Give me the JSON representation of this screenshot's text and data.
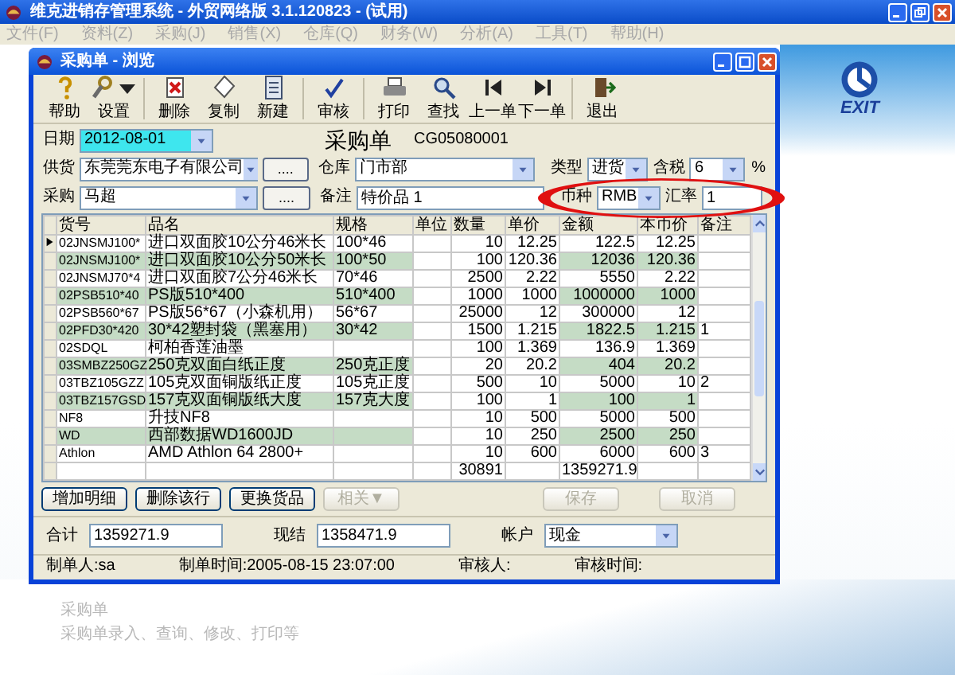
{
  "app": {
    "title": "维克进销存管理系统 - 外贸网络版 3.1.120823 - (试用)",
    "menu": [
      "文件(F)",
      "资料(Z)",
      "采购(J)",
      "销售(X)",
      "仓库(Q)",
      "财务(W)",
      "分析(A)",
      "工具(T)",
      "帮助(H)"
    ]
  },
  "dialog": {
    "title": "采购单 - 浏览",
    "toolbar": [
      {
        "label": "帮助",
        "has_menu": false
      },
      {
        "label": "设置",
        "has_menu": true
      },
      {
        "label": "删除",
        "has_menu": false
      },
      {
        "label": "复制",
        "has_menu": false
      },
      {
        "label": "新建",
        "has_menu": false
      },
      {
        "label": "审核",
        "has_menu": false
      },
      {
        "label": "打印",
        "has_menu": false
      },
      {
        "label": "查找",
        "has_menu": false
      },
      {
        "label": "上一单",
        "has_menu": false
      },
      {
        "label": "下一单",
        "has_menu": false
      },
      {
        "label": "退出",
        "has_menu": false
      }
    ],
    "form": {
      "heading": "采购单",
      "number": "CG05080001",
      "date": {
        "label": "日期",
        "value": "2012-08-01",
        "focused": true
      },
      "supplier": {
        "label": "供货",
        "value": "东莞莞东电子有限公司",
        "browse": "...."
      },
      "warehouse": {
        "label": "仓库",
        "value": "门市部"
      },
      "type": {
        "label": "类型",
        "value": "进货"
      },
      "tax": {
        "label": "含税",
        "value": "6",
        "unit": "%"
      },
      "buyer": {
        "label": "采购",
        "value": "马超",
        "browse": "...."
      },
      "note": {
        "label": "备注",
        "value": "特价品 1"
      },
      "currency": {
        "label": "币种",
        "value": "RMB"
      },
      "rate": {
        "label": "汇率",
        "value": "1"
      }
    },
    "table": {
      "columns": [
        "货号",
        "品名",
        "规格",
        "单位",
        "数量",
        "单价",
        "金额",
        "本币价",
        "备注"
      ],
      "rows": [
        {
          "selected": true,
          "cells": [
            "02JNSMJ100*",
            "进口双面胶10公分46米长",
            "100*46",
            "",
            "10",
            "12.25",
            "122.5",
            "12.25",
            ""
          ]
        },
        {
          "selected": false,
          "cells": [
            "02JNSMJ100*",
            "进口双面胶10公分50米长",
            "100*50",
            "",
            "100",
            "120.36",
            "12036",
            "120.36",
            ""
          ]
        },
        {
          "selected": false,
          "cells": [
            "02JNSMJ70*4",
            "进口双面胶7公分46米长",
            "70*46",
            "",
            "2500",
            "2.22",
            "5550",
            "2.22",
            ""
          ]
        },
        {
          "selected": false,
          "cells": [
            "02PSB510*40",
            "PS版510*400",
            "510*400",
            "",
            "1000",
            "1000",
            "1000000",
            "1000",
            ""
          ]
        },
        {
          "selected": false,
          "cells": [
            "02PSB560*67",
            "PS版56*67（小森机用）",
            "56*67",
            "",
            "25000",
            "12",
            "300000",
            "12",
            ""
          ]
        },
        {
          "selected": false,
          "cells": [
            "02PFD30*420",
            "30*42塑封袋（黑塞用）",
            "30*42",
            "",
            "1500",
            "1.215",
            "1822.5",
            "1.215",
            "1"
          ]
        },
        {
          "selected": false,
          "cells": [
            "02SDQL",
            "柯柏香莲油墨",
            "",
            "",
            "100",
            "1.369",
            "136.9",
            "1.369",
            ""
          ]
        },
        {
          "selected": false,
          "cells": [
            "03SMBZ250GZ",
            "250克双面白纸正度",
            "250克正度",
            "",
            "20",
            "20.2",
            "404",
            "20.2",
            ""
          ]
        },
        {
          "selected": false,
          "cells": [
            "03TBZ105GZZ",
            "105克双面铜版纸正度",
            "105克正度",
            "",
            "500",
            "10",
            "5000",
            "10",
            "2"
          ]
        },
        {
          "selected": false,
          "cells": [
            "03TBZ157GSD",
            "157克双面铜版纸大度",
            "157克大度",
            "",
            "100",
            "1",
            "100",
            "1",
            ""
          ]
        },
        {
          "selected": false,
          "cells": [
            "NF8",
            "升技NF8",
            "",
            "",
            "10",
            "500",
            "5000",
            "500",
            ""
          ]
        },
        {
          "selected": false,
          "cells": [
            "WD",
            "西部数据WD1600JD",
            "",
            "",
            "10",
            "250",
            "2500",
            "250",
            ""
          ]
        },
        {
          "selected": false,
          "cells": [
            "Athlon",
            "AMD Athlon 64 2800+",
            "",
            "",
            "10",
            "600",
            "6000",
            "600",
            "3"
          ]
        }
      ],
      "totals": {
        "quantity": "30891",
        "amount": "1359271.9"
      }
    },
    "buttons": [
      {
        "label": "增加明细",
        "disabled": false
      },
      {
        "label": "删除该行",
        "disabled": false
      },
      {
        "label": "更换货品",
        "disabled": false
      },
      {
        "label": "相关▼",
        "disabled": true
      },
      {
        "label": "保存",
        "disabled": true
      },
      {
        "label": "取消",
        "disabled": true
      }
    ],
    "summary": [
      {
        "kind": "field",
        "label": "合计",
        "value": "1359271.9"
      },
      {
        "kind": "field",
        "label": "现结",
        "value": "1358471.9"
      },
      {
        "kind": "combo",
        "label": "帐户",
        "value": "现金"
      }
    ],
    "status": [
      "制单人:sa",
      "制单时间:2005-08-15 23:07:00",
      "审核人:",
      "审核时间:"
    ]
  },
  "desktop": {
    "exit_label": "EXIT",
    "module_title": "采购单",
    "module_description": "采购单录入、查询、修改、打印等"
  }
}
